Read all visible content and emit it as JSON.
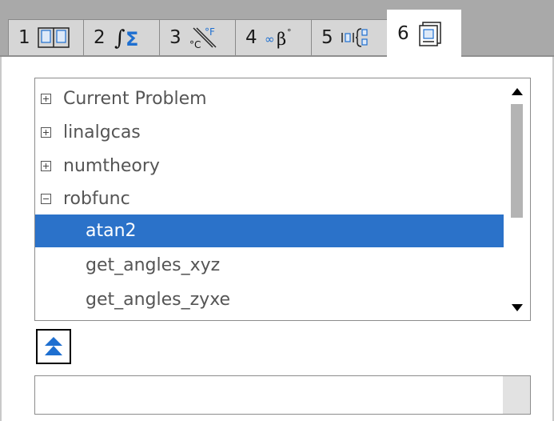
{
  "tabs": [
    {
      "number": "1",
      "icon": "book-icon"
    },
    {
      "number": "2",
      "icon": "integral-sigma-icon"
    },
    {
      "number": "3",
      "icon": "unit-conversion-icon"
    },
    {
      "number": "4",
      "icon": "symbols-icon"
    },
    {
      "number": "5",
      "icon": "templates-icon"
    },
    {
      "number": "6",
      "icon": "library-icon",
      "active": true
    }
  ],
  "tree": {
    "items": [
      {
        "label": "Current Problem",
        "expander": "plus"
      },
      {
        "label": "linalgcas",
        "expander": "plus"
      },
      {
        "label": "numtheory",
        "expander": "plus"
      },
      {
        "label": "robfunc",
        "expander": "minus"
      },
      {
        "label": "atan2",
        "selected": true
      },
      {
        "label": "get_angles_xyz"
      },
      {
        "label": "get_angles_zyxe"
      }
    ]
  },
  "input": {
    "value": ""
  },
  "colors": {
    "selection": "#2b72c9",
    "tab_bar": "#a9a9a9",
    "icon_blue": "#1e6fd0"
  }
}
